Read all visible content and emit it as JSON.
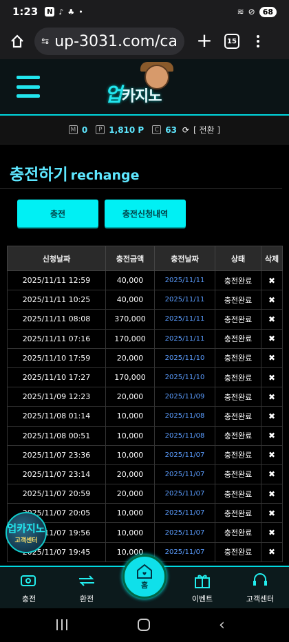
{
  "status_bar": {
    "time": "1:23",
    "battery": "68"
  },
  "browser": {
    "url": "up-3031.com/ca",
    "tab_count": "15"
  },
  "site": {
    "logo_main": "업",
    "logo_sub": "카지노"
  },
  "points": {
    "m_label": "M",
    "m_value": "0",
    "p_label": "P",
    "p_value": "1,810 P",
    "c_label": "C",
    "c_value": "63",
    "switch_label": "[ 전환 ]"
  },
  "page": {
    "title": "충전하기",
    "subtitle": "rechange"
  },
  "buttons": {
    "charge": "충전",
    "history": "충전신청내역"
  },
  "table": {
    "headers": [
      "신청날짜",
      "충전금액",
      "충전날짜",
      "상태",
      "삭제"
    ],
    "rows": [
      [
        "2025/11/11 12:59",
        "40,000",
        "2025/11/11",
        "충전완료",
        "✖"
      ],
      [
        "2025/11/11 10:25",
        "40,000",
        "2025/11/11",
        "충전완료",
        "✖"
      ],
      [
        "2025/11/11 08:08",
        "370,000",
        "2025/11/11",
        "충전완료",
        "✖"
      ],
      [
        "2025/11/11 07:16",
        "170,000",
        "2025/11/11",
        "충전완료",
        "✖"
      ],
      [
        "2025/11/10 17:59",
        "20,000",
        "2025/11/10",
        "충전완료",
        "✖"
      ],
      [
        "2025/11/10 17:27",
        "170,000",
        "2025/11/10",
        "충전완료",
        "✖"
      ],
      [
        "2025/11/09 12:23",
        "20,000",
        "2025/11/09",
        "충전완료",
        "✖"
      ],
      [
        "2025/11/08 01:14",
        "10,000",
        "2025/11/08",
        "충전완료",
        "✖"
      ],
      [
        "2025/11/08 00:51",
        "10,000",
        "2025/11/08",
        "충전완료",
        "✖"
      ],
      [
        "2025/11/07 23:36",
        "10,000",
        "2025/11/07",
        "충전완료",
        "✖"
      ],
      [
        "2025/11/07 23:14",
        "20,000",
        "2025/11/07",
        "충전완료",
        "✖"
      ],
      [
        "2025/11/07 20:59",
        "20,000",
        "2025/11/07",
        "충전완료",
        "✖"
      ],
      [
        "2025/11/07 20:05",
        "10,000",
        "2025/11/07",
        "충전완료",
        "✖"
      ],
      [
        "2025/11/07 19:56",
        "10,000",
        "2025/11/07",
        "충전완료",
        "✖"
      ],
      [
        "2025/11/07 19:45",
        "10,000",
        "2025/11/07",
        "충전완료",
        "✖"
      ]
    ]
  },
  "floating_badge": {
    "line1": "업카지노",
    "line2": "고객센터"
  },
  "bottom_nav": [
    {
      "label": "충전",
      "icon": "charge-icon"
    },
    {
      "label": "환전",
      "icon": "exchange-icon"
    },
    {
      "label": "홈",
      "icon": "home-icon"
    },
    {
      "label": "이벤트",
      "icon": "gift-icon"
    },
    {
      "label": "고객센터",
      "icon": "support-icon"
    }
  ]
}
